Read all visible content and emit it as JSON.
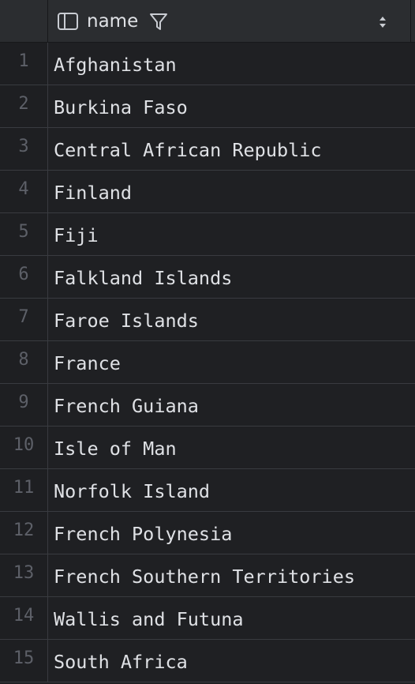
{
  "table": {
    "column": {
      "name": "name",
      "icon": "column-layout-icon",
      "filter_icon": "filter-icon",
      "sort_icon": "sort-arrows-icon"
    },
    "rows": [
      {
        "num": "1",
        "name": "Afghanistan"
      },
      {
        "num": "2",
        "name": "Burkina Faso"
      },
      {
        "num": "3",
        "name": "Central African Republic"
      },
      {
        "num": "4",
        "name": "Finland"
      },
      {
        "num": "5",
        "name": "Fiji"
      },
      {
        "num": "6",
        "name": "Falkland Islands"
      },
      {
        "num": "7",
        "name": "Faroe Islands"
      },
      {
        "num": "8",
        "name": "France"
      },
      {
        "num": "9",
        "name": "French Guiana"
      },
      {
        "num": "10",
        "name": "Isle of Man"
      },
      {
        "num": "11",
        "name": "Norfolk Island"
      },
      {
        "num": "12",
        "name": "French Polynesia"
      },
      {
        "num": "13",
        "name": "French Southern Territories"
      },
      {
        "num": "14",
        "name": "Wallis and Futuna"
      },
      {
        "num": "15",
        "name": "South Africa"
      }
    ]
  },
  "colors": {
    "background": "#1f2023",
    "header": "#2b2d30",
    "text": "#dfe1e5",
    "row_number": "#5d6068",
    "grid_line": "#393b40"
  }
}
